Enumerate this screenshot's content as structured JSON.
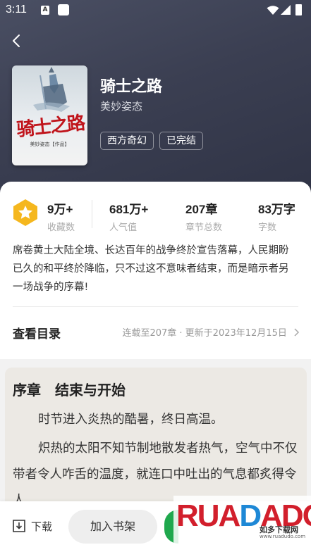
{
  "status": {
    "time": "3:11",
    "notif_icon_letter": "A"
  },
  "book": {
    "title": "骑士之路",
    "author": "美妙姿态",
    "cover_title": "骑士之路",
    "cover_author": "美妙姿态【作品】",
    "tags": [
      "西方奇幻",
      "已完结"
    ]
  },
  "stats": [
    {
      "value": "9万+",
      "label": "收藏数"
    },
    {
      "value": "681万+",
      "label": "人气值"
    },
    {
      "value": "207章",
      "label": "章节总数"
    },
    {
      "value": "83万字",
      "label": "字数"
    }
  ],
  "description": "席卷黄土大陆全境、长达百年的战争终於宣告落幕，人民期盼已久的和平终於降临，只不过这不意味者结束，而是暗示者另一场战争的序幕!",
  "toc": {
    "label": "查看目录",
    "info": "连载至207章 · 更新于2023年12月15日"
  },
  "chapter": {
    "title": "序章　结束与开始",
    "paragraphs": [
      "时节进入炎热的酷暑，终日高温。",
      "炽热的太阳不知节制地散发者热气，空气中不仅带者令人咋舌的温度，就连口中吐出的气息都炙得令人..."
    ]
  },
  "bottom": {
    "download_label": "下载",
    "add_shelf_label": "加入书架"
  },
  "watermark": {
    "logo": "RUADADO",
    "cn": "如多下载网",
    "url": "www.ruadudo.com"
  },
  "colors": {
    "hero": "#3b3f52",
    "badge": "#f5b71e",
    "accent_green": "#1fa84d"
  },
  "icons": [
    "back-arrow-icon",
    "star-badge-icon",
    "chevron-right-icon",
    "download-icon",
    "wifi-icon",
    "signal-icon",
    "battery-icon"
  ]
}
